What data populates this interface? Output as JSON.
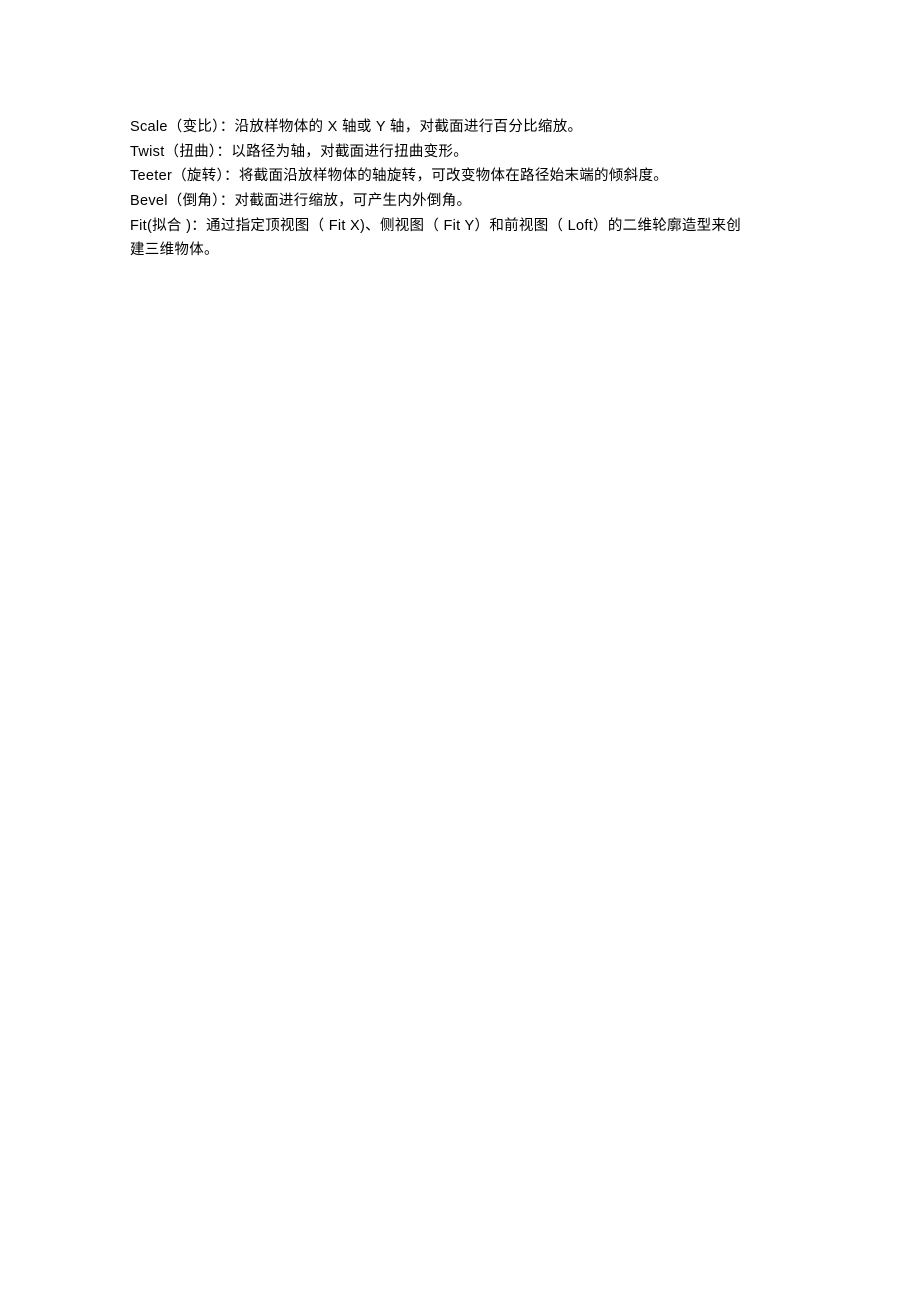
{
  "lines": [
    "Scale（变比）：沿放样物体的   X 轴或 Y 轴，对截面进行百分比缩放。",
    "Twist（扭曲）：以路径为轴，对截面进行扭曲变形。",
    "Teeter（旋转）：将截面沿放样物体的轴旋转，可改变物体在路径始末端的倾斜度。",
    "Bevel（倒角）：对截面进行缩放，可产生内外倒角。",
    "Fit(拟合 )：通过指定顶视图（   Fit X)、侧视图（ Fit Y）和前视图（ Loft）的二维轮廓造型来创",
    "建三维物体。"
  ]
}
